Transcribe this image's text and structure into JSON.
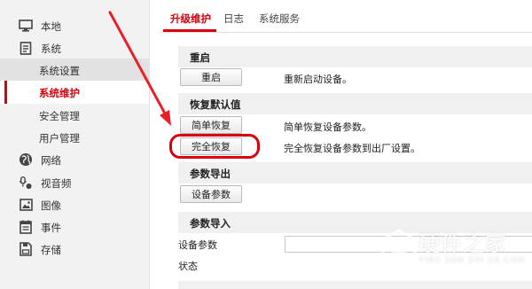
{
  "sidebar": {
    "items": [
      {
        "label": "本地",
        "icon": "monitor-icon"
      },
      {
        "label": "系统",
        "icon": "document-icon"
      },
      {
        "label": "系统设置"
      },
      {
        "label": "系统维护"
      },
      {
        "label": "安全管理"
      },
      {
        "label": "用户管理"
      },
      {
        "label": "网络",
        "icon": "globe-icon"
      },
      {
        "label": "视音频",
        "icon": "audio-video-icon"
      },
      {
        "label": "图像",
        "icon": "image-icon"
      },
      {
        "label": "事件",
        "icon": "calendar-icon"
      },
      {
        "label": "存储",
        "icon": "storage-icon"
      }
    ]
  },
  "tabs": [
    {
      "label": "升级维护"
    },
    {
      "label": "日志"
    },
    {
      "label": "系统服务"
    }
  ],
  "sections": {
    "reboot": {
      "title": "重启",
      "button": "重启",
      "desc": "重新启动设备。"
    },
    "restore": {
      "title": "恢复默认值",
      "simple_button": "简单恢复",
      "simple_desc": "简单恢复设备参数。",
      "full_button": "完全恢复",
      "full_desc": "完全恢复设备参数到出厂设置。"
    },
    "export": {
      "title": "参数导出",
      "button": "设备参数"
    },
    "import": {
      "title": "参数导入",
      "field_label": "设备参数",
      "status_label": "状态"
    }
  },
  "watermark": {
    "title": "硬件之家",
    "subtitle": "YING JIAN ZHI JIA.COM"
  },
  "colors": {
    "accent": "#d6000f",
    "sidebar_bg": "#f2f2f2",
    "section_bg": "#f0f0f0"
  }
}
